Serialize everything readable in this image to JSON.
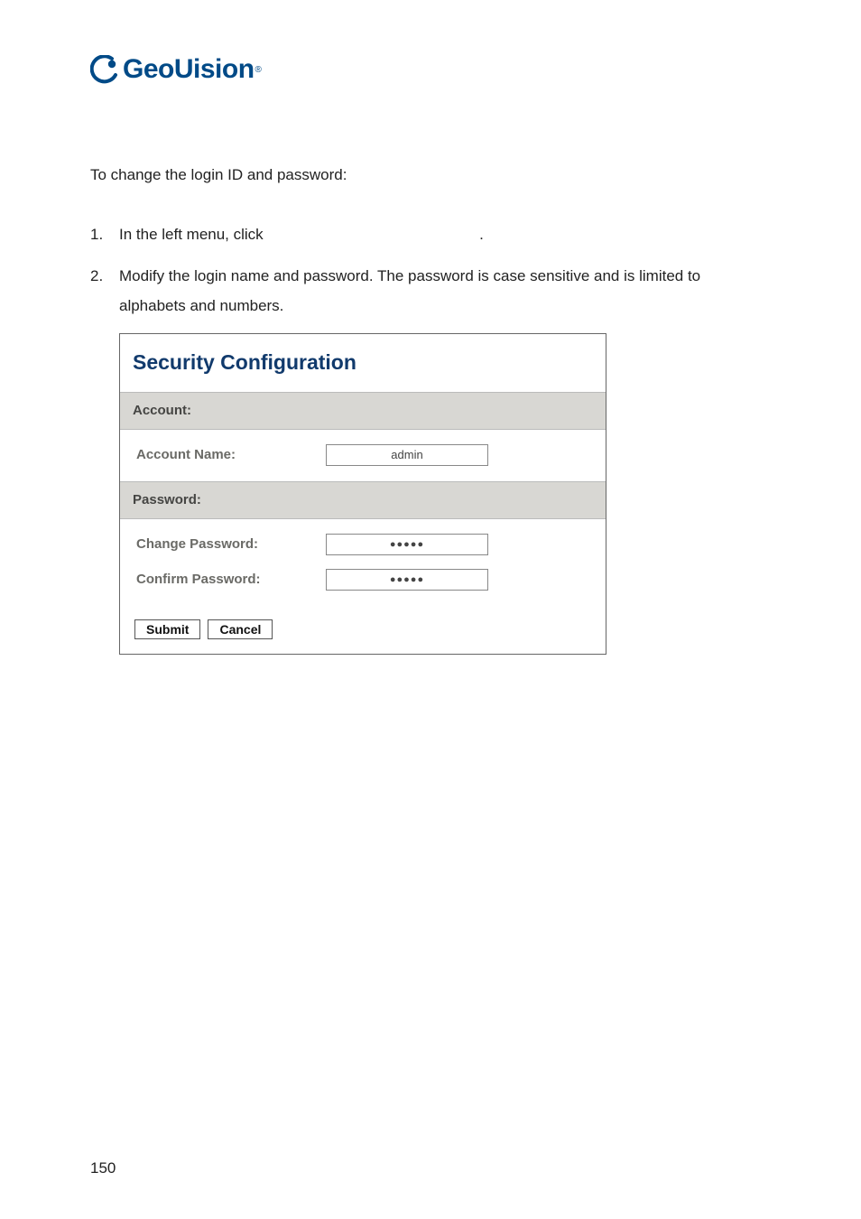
{
  "logo": {
    "brand": "GeoUision"
  },
  "intro": "To change the login ID and password:",
  "steps": {
    "s1_num": "1.",
    "s1_text": "In the left menu, click",
    "s1_tail": ".",
    "s2_num": "2.",
    "s2_text": "Modify the login name and password. The password is case sensitive and is limited to alphabets and numbers."
  },
  "figure": {
    "title": "Security Configuration",
    "account_section": "Account:",
    "account_name_label": "Account Name:",
    "account_name_value": "admin",
    "password_section": "Password:",
    "change_pw_label": "Change Password:",
    "confirm_pw_label": "Confirm Password:",
    "pw_dots": "●●●●●",
    "submit_label": "Submit",
    "cancel_label": "Cancel"
  },
  "page_number": "150"
}
